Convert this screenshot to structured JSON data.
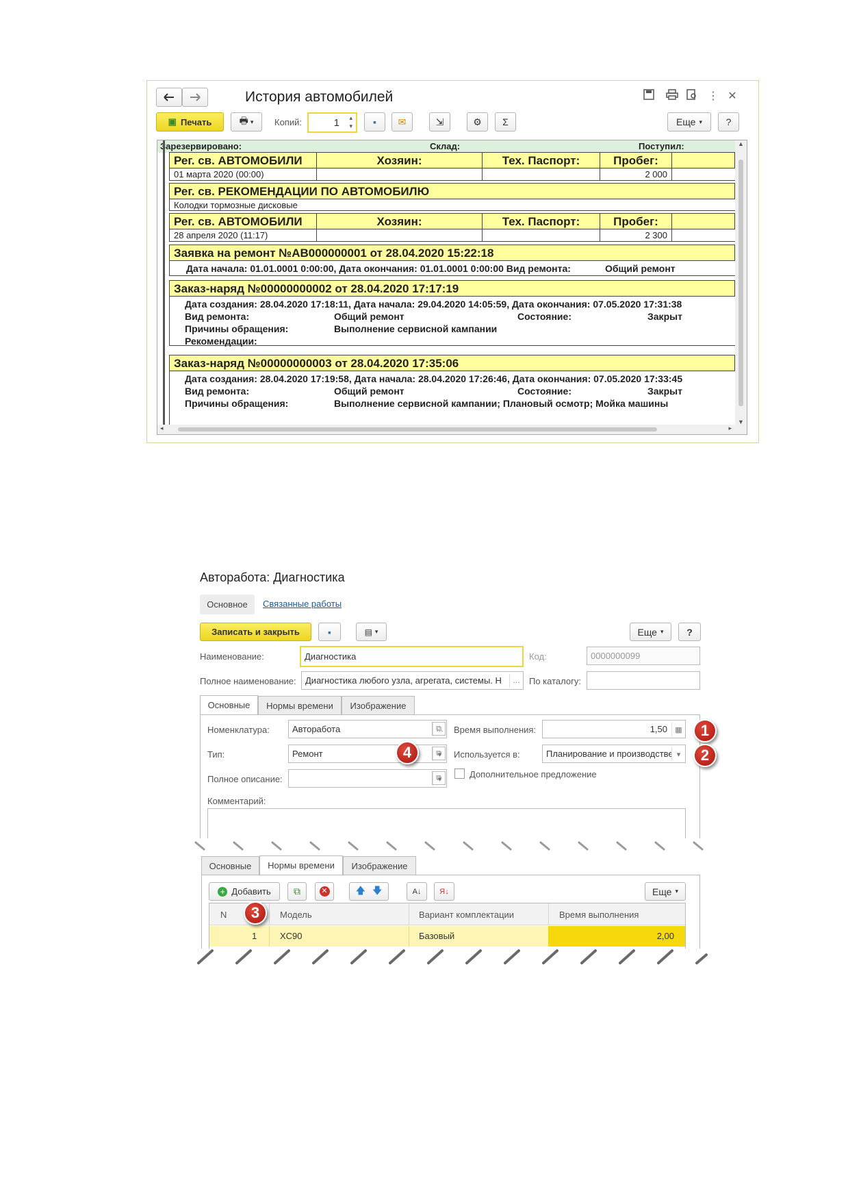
{
  "report_window": {
    "title": "История автомобилей",
    "print_button": "Печать",
    "copies_label": "Копий:",
    "copies_value": "1",
    "more_button": "Еще",
    "help_button": "?",
    "header_strip": {
      "left": "Зарезервировано:",
      "mid": "Склад:",
      "right": "Поступил:"
    },
    "sections": [
      {
        "title": "Рег. св. АВТОМОБИЛИ",
        "col_owner": "Хозяин:",
        "col_passport": "Тех. Паспорт:",
        "col_mileage": "Пробег:",
        "date": "01 марта 2020 (00:00)",
        "mileage": "2 000"
      },
      {
        "title": "Рег. св. РЕКОМЕНДАЦИИ ПО АВТОМОБИЛЮ",
        "value": "Колодки тормозные дисковые"
      },
      {
        "title": "Рег. св. АВТОМОБИЛИ",
        "col_owner": "Хозяин:",
        "col_passport": "Тех. Паспорт:",
        "col_mileage": "Пробег:",
        "date": "28 апреля 2020 (11:17)",
        "mileage": "2 300"
      },
      {
        "title": "Заявка на ремонт №АВ000000001 от 28.04.2020 15:22:18",
        "line1": "Дата начала: 01.01.0001 0:00:00, Дата окончания: 01.01.0001 0:00:00  Вид ремонта:",
        "line1_right": "Общий ремонт"
      },
      {
        "title": "Заказ-наряд №00000000002 от 28.04.2020 17:17:19",
        "line1": "Дата создания: 28.04.2020 17:18:11, Дата начала: 29.04.2020 14:05:59, Дата окончания: 07.05.2020 17:31:38",
        "repair_type_label": "Вид ремонта:",
        "repair_type": "Общий ремонт",
        "state_label": "Состояние:",
        "state": "Закрыт",
        "reasons_label": "Причины обращения:",
        "reasons": "Выполнение сервисной кампании",
        "recs_label": "Рекомендации:"
      },
      {
        "title": "Заказ-наряд №00000000003 от 28.04.2020 17:35:06",
        "line1": "Дата создания: 28.04.2020 17:19:58, Дата начала: 28.04.2020 17:26:46, Дата окончания: 07.05.2020 17:33:45",
        "repair_type_label": "Вид ремонта:",
        "repair_type": "Общий ремонт",
        "state_label": "Состояние:",
        "state": "Закрыт",
        "reasons_label": "Причины обращения:",
        "reasons": "Выполнение сервисной кампании; Плановый осмотр; Мойка машины"
      }
    ]
  },
  "form": {
    "title": "Авторабота: Диагностика",
    "top_tabs": [
      "Основное",
      "Связанные работы"
    ],
    "save_close": "Записать и закрыть",
    "more_button": "Еще",
    "help_button": "?",
    "name_label": "Наименование:",
    "name_value": "Диагностика",
    "code_label": "Код:",
    "code_value": "0000000099",
    "fullname_label": "Полное наименование:",
    "fullname_value": "Диагностика любого узла, агрегата, системы. Н",
    "catalog_label": "По каталогу:",
    "tabs": [
      "Основные",
      "Нормы времени",
      "Изображение"
    ],
    "nomenclature_label": "Номенклатура:",
    "nomenclature_value": "Авторабота",
    "time_label": "Время выполнения:",
    "time_value": "1,50",
    "type_label": "Тип:",
    "type_value": "Ремонт",
    "used_label": "Используется в:",
    "used_value": "Планирование и производстве",
    "fulldesc_label": "Полное описание:",
    "extra_offer": "Дополнительное предложение",
    "comment_label": "Комментарий:",
    "norms": {
      "add_button": "Добавить",
      "more_button": "Еще",
      "columns": [
        "N",
        "Модель",
        "Вариант комплектации",
        "Время выполнения"
      ],
      "row": {
        "n": "1",
        "model": "XC90",
        "variant": "Базовый",
        "time": "2,00"
      }
    },
    "callouts": [
      "1",
      "2",
      "3",
      "4"
    ]
  },
  "colors": {
    "accent_yellow": "#ffff9e",
    "button_yellow": "#f5e03a",
    "callout_red": "#c0261a"
  }
}
